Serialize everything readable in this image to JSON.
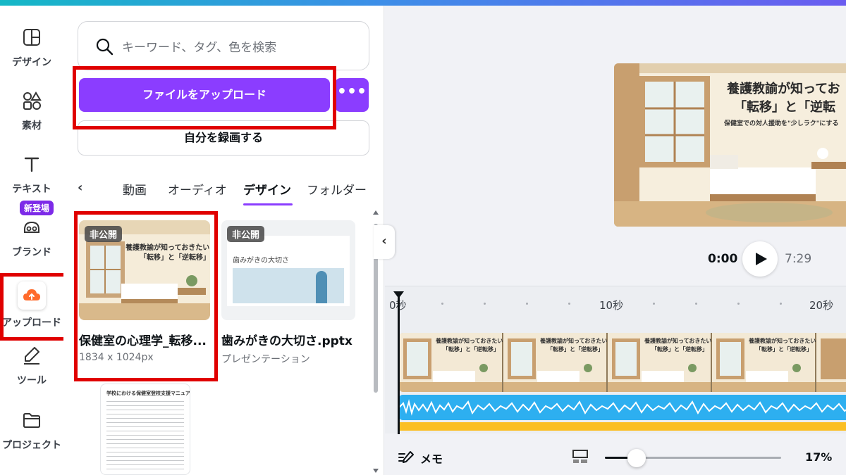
{
  "rail": {
    "items": [
      {
        "label": "デザイン",
        "icon": "layout-icon"
      },
      {
        "label": "素材",
        "icon": "shapes-icon"
      },
      {
        "label": "テキスト",
        "icon": "text-icon"
      },
      {
        "label": "ブランド",
        "icon": "brand-icon"
      },
      {
        "label": "アップロード",
        "icon": "cloud-upload-icon"
      },
      {
        "label": "ツール",
        "icon": "draw-icon"
      },
      {
        "label": "プロジェクト",
        "icon": "folder-icon"
      }
    ],
    "new_badge": "新登場"
  },
  "panel": {
    "search_placeholder": "キーワード、タグ、色を検索",
    "upload_button": "ファイルをアップロード",
    "more_button": "•••",
    "record_button": "自分を録画する",
    "tabs": [
      "動画",
      "オーディオ",
      "デザイン",
      "フォルダー"
    ],
    "active_tab": "デザイン",
    "cards": [
      {
        "badge": "非公開",
        "title": "保健室の心理学_転移...",
        "subtitle": "1834 x 1024px",
        "thumb_line1": "養護教諭が知っておきたい",
        "thumb_line2": "「転移」と「逆転移」"
      },
      {
        "badge": "非公開",
        "title": "歯みがきの大切さ.pptx",
        "subtitle": "プレゼンテーション",
        "thumb_heading": "歯みがきの大切さ"
      }
    ],
    "doc_thumb_title": "学校における保健室登校支援マニュアル"
  },
  "preview": {
    "title_line1": "養護教諭が知ってお",
    "title_line2": "「転移」と「逆転",
    "subtitle": "保健室での対人援助を\"少しラク\"にする"
  },
  "player": {
    "current_time": "0:00",
    "total_time": "7:29"
  },
  "timeline": {
    "ticks": [
      "0秒",
      "10秒",
      "20秒"
    ],
    "frame_title": "養護教諭が知っておきたい",
    "frame_sub": "「転移」と「逆転移」"
  },
  "bottom": {
    "memo_label": "メモ",
    "zoom_label": "17%",
    "zoom_fraction": 0.17
  },
  "colors": {
    "accent": "#8b3dff",
    "highlight": "#e00000",
    "audio": "#2daff0",
    "track": "#fbbf24"
  }
}
